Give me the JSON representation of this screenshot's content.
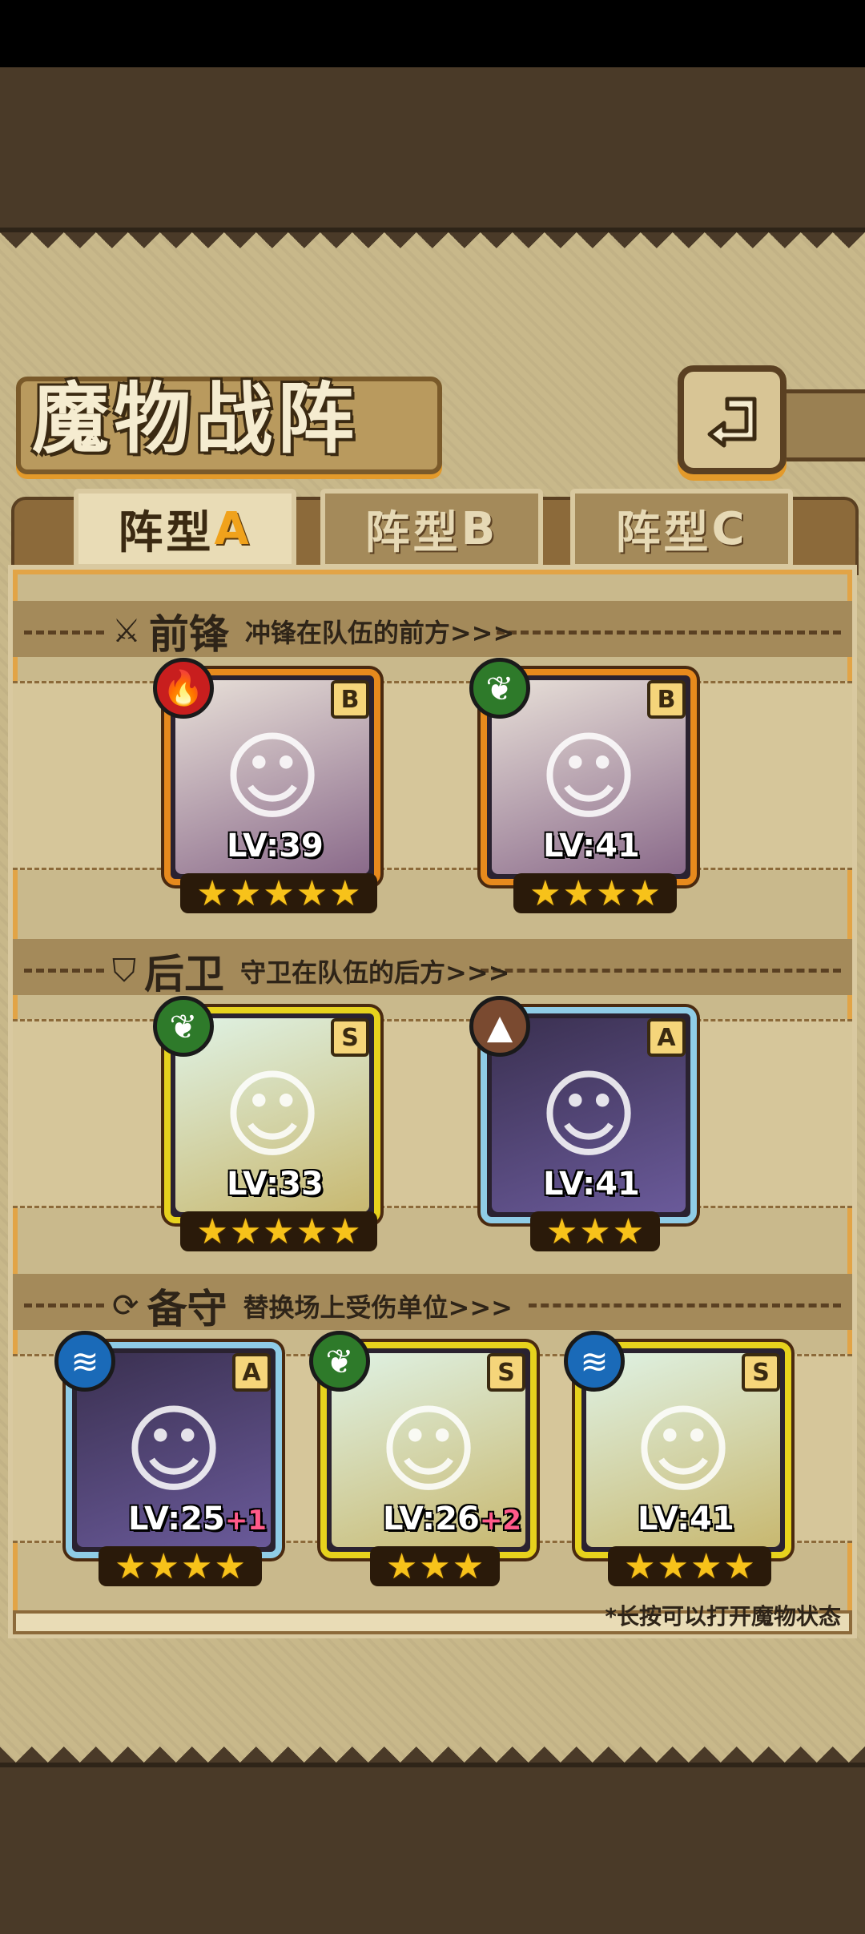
{
  "title": "魔物战阵",
  "tabs": [
    {
      "label": "阵型",
      "letter": "A",
      "active": true
    },
    {
      "label": "阵型",
      "letter": "B",
      "active": false
    },
    {
      "label": "阵型",
      "letter": "C",
      "active": false
    }
  ],
  "sections": {
    "front": {
      "icon": "sword-icon",
      "name": "前锋",
      "desc": "冲锋在队伍的前方>>>"
    },
    "back": {
      "icon": "shield-icon",
      "name": "后卫",
      "desc": "守卫在队伍的后方>>>"
    },
    "reserve": {
      "icon": "swap-icon",
      "name": "备守",
      "desc": "替换场上受伤单位>>>"
    }
  },
  "monsters": {
    "front": [
      {
        "element": "fire",
        "rank": "B",
        "level": "LV:39",
        "plus": "",
        "stars": 5,
        "frame": "orange"
      },
      {
        "element": "grass",
        "rank": "B",
        "level": "LV:41",
        "plus": "",
        "stars": 4,
        "frame": "orange"
      }
    ],
    "back": [
      {
        "element": "grass",
        "rank": "S",
        "level": "LV:33",
        "plus": "",
        "stars": 5,
        "frame": "gold"
      },
      {
        "element": "earth",
        "rank": "A",
        "level": "LV:41",
        "plus": "",
        "stars": 3,
        "frame": "blue"
      }
    ],
    "reserve": [
      {
        "element": "water",
        "rank": "A",
        "level": "LV:25",
        "plus": "+1",
        "stars": 4,
        "frame": "blue"
      },
      {
        "element": "grass",
        "rank": "S",
        "level": "LV:26",
        "plus": "+2",
        "stars": 3,
        "frame": "gold"
      },
      {
        "element": "water",
        "rank": "S",
        "level": "LV:41",
        "plus": "",
        "stars": 4,
        "frame": "gold"
      }
    ]
  },
  "star_glyph": "★",
  "footnote": "*长按可以打开魔物状态",
  "colors": {
    "fire": "#c81e1e",
    "grass": "#2e7a2a",
    "earth": "#7a4a30",
    "water": "#1a6ab8"
  }
}
